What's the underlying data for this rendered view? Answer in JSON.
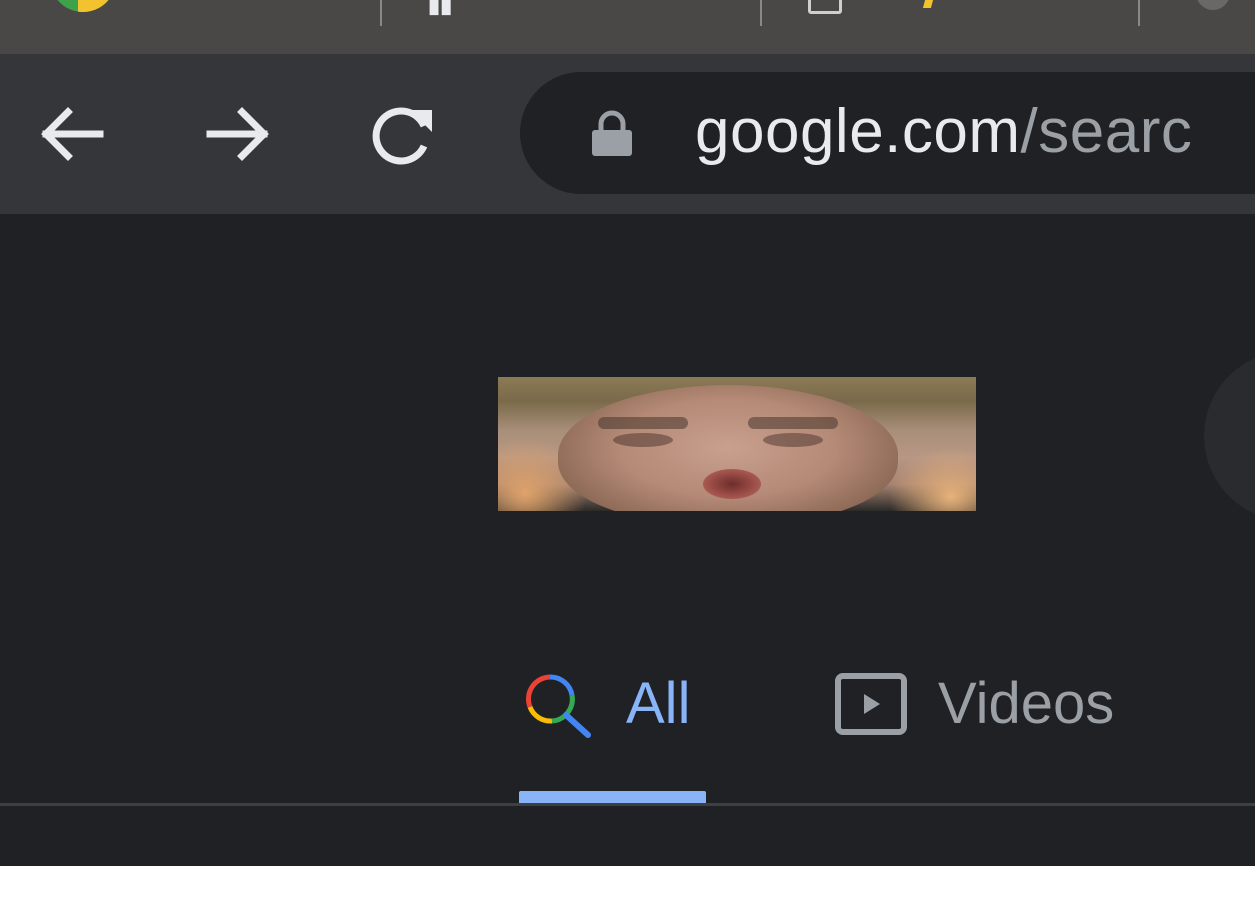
{
  "browser": {
    "url_host": "google.com",
    "url_path": "/searc",
    "nav": {
      "back_icon": "arrow-left-icon",
      "forward_icon": "arrow-right-icon",
      "reload_icon": "reload-icon",
      "lock_icon": "lock-icon"
    },
    "colors": {
      "tab_strip": "#4a4846",
      "toolbar": "#35363a",
      "omnibox": "#202124"
    }
  },
  "search": {
    "tabs": [
      {
        "label": "All",
        "icon": "google-search-icon",
        "selected": true
      },
      {
        "label": "Videos",
        "icon": "video-play-icon",
        "selected": false
      }
    ],
    "colors": {
      "background": "#202124",
      "active_tab": "#8ab4f8",
      "inactive_tab": "#9aa0a6"
    }
  }
}
